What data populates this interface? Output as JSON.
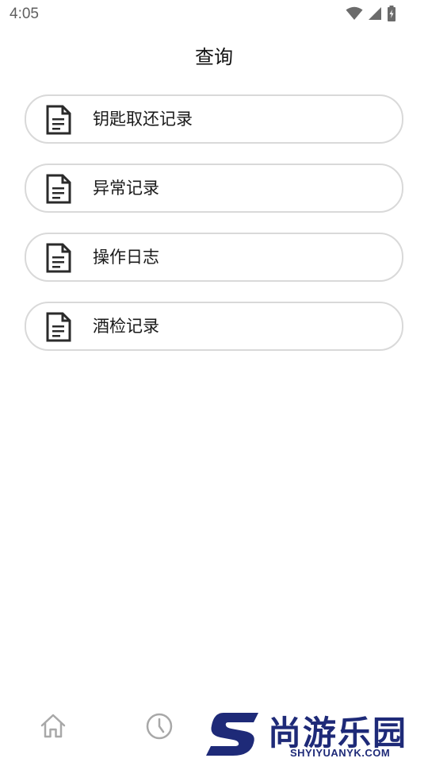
{
  "status_bar": {
    "time": "4:05",
    "icons": [
      "wifi-icon",
      "cell-signal-icon",
      "battery-charging-icon"
    ]
  },
  "header": {
    "title": "查询"
  },
  "menu": {
    "items": [
      {
        "label": "钥匙取还记录",
        "icon": "document-icon"
      },
      {
        "label": "异常记录",
        "icon": "document-icon"
      },
      {
        "label": "操作日志",
        "icon": "document-icon"
      },
      {
        "label": "酒检记录",
        "icon": "document-icon"
      }
    ]
  },
  "bottom_nav": {
    "items": [
      {
        "icon": "home-icon"
      },
      {
        "icon": "clock-icon"
      }
    ]
  },
  "watermark": {
    "text": "尚游乐园",
    "url": "SHYIYUANYK.COM"
  },
  "colors": {
    "border": "#d9d9d9",
    "text": "#1a1a1a",
    "nav_icon": "#a8a8a8",
    "watermark_blue": "#1e2a78",
    "watermark_red": "#e8323c"
  }
}
